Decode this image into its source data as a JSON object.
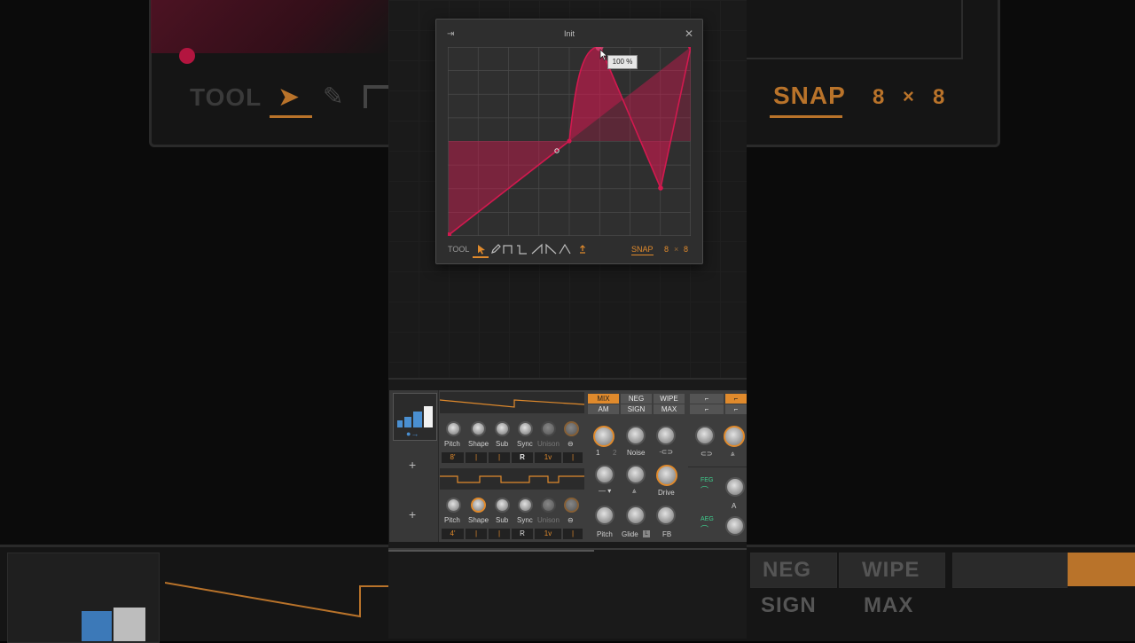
{
  "editor": {
    "title": "Init",
    "tooltip": "100 %",
    "toolbar": {
      "tool_label": "TOOL",
      "snap_label": "SNAP",
      "grid_x": "8",
      "grid_sep": "×",
      "grid_y": "8"
    }
  },
  "background": {
    "tool_label": "TOOL",
    "snap_label": "SNAP",
    "grid_x": "8",
    "grid_sep": "×",
    "grid_y": "8",
    "neg": "NEG",
    "wipe": "WIPE",
    "sign": "SIGN",
    "max": "MAX"
  },
  "device": {
    "osc1": {
      "knobs": [
        "Pitch",
        "Shape",
        "Sub",
        "Sync",
        "Unison"
      ],
      "values": [
        "8'",
        "R",
        "1v"
      ]
    },
    "osc2": {
      "knobs": [
        "Pitch",
        "Shape",
        "Sub",
        "Sync",
        "Unison"
      ],
      "values": [
        "4'",
        "R",
        "1v"
      ]
    },
    "mix_buttons": [
      "MIX",
      "NEG",
      "WIPE",
      "AM",
      "SIGN",
      "MAX"
    ],
    "mix_labels": {
      "one": "1",
      "two": "2",
      "noise": "Noise",
      "drive": "Drive",
      "pitch": "Pitch",
      "glide": "Glide",
      "fb": "FB"
    },
    "filter": {
      "feg": "FEG",
      "aeg": "AEG",
      "a": "A"
    }
  },
  "colors": {
    "accent": "#e08a2c",
    "curve": "#d2194f",
    "env_green": "#3fcf8e"
  }
}
